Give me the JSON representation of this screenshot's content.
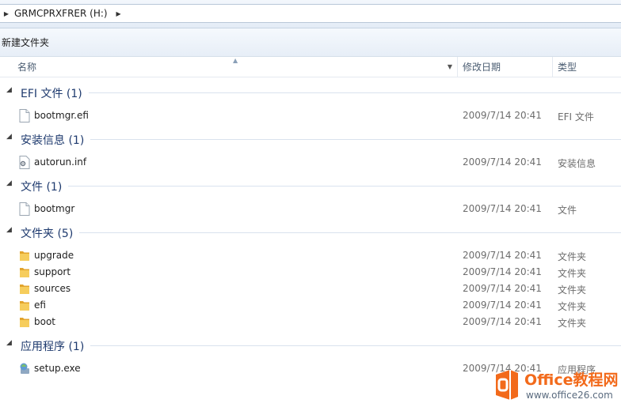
{
  "address": {
    "path": "GRMCPRXFRER (H:)"
  },
  "toolbar": {
    "new_folder": "新建文件夹"
  },
  "columns": {
    "name": "名称",
    "date": "修改日期",
    "type": "类型"
  },
  "groups": [
    {
      "title": "EFI 文件 (1)",
      "items": [
        {
          "name": "bootmgr.efi",
          "date": "2009/7/14 20:41",
          "type": "EFI 文件",
          "icon": "file-icon"
        }
      ]
    },
    {
      "title": "安装信息 (1)",
      "items": [
        {
          "name": "autorun.inf",
          "date": "2009/7/14 20:41",
          "type": "安装信息",
          "icon": "setup-info-icon"
        }
      ]
    },
    {
      "title": "文件 (1)",
      "items": [
        {
          "name": "bootmgr",
          "date": "2009/7/14 20:41",
          "type": "文件",
          "icon": "file-icon"
        }
      ]
    },
    {
      "title": "文件夹 (5)",
      "items": [
        {
          "name": "upgrade",
          "date": "2009/7/14 20:41",
          "type": "文件夹",
          "icon": "folder-icon"
        },
        {
          "name": "support",
          "date": "2009/7/14 20:41",
          "type": "文件夹",
          "icon": "folder-icon"
        },
        {
          "name": "sources",
          "date": "2009/7/14 20:41",
          "type": "文件夹",
          "icon": "folder-icon"
        },
        {
          "name": "efi",
          "date": "2009/7/14 20:41",
          "type": "文件夹",
          "icon": "folder-icon"
        },
        {
          "name": "boot",
          "date": "2009/7/14 20:41",
          "type": "文件夹",
          "icon": "folder-icon"
        }
      ]
    },
    {
      "title": "应用程序 (1)",
      "items": [
        {
          "name": "setup.exe",
          "date": "2009/7/14 20:41",
          "type": "应用程序",
          "icon": "setup-exe-icon"
        }
      ]
    }
  ],
  "watermark": {
    "title": "Office教程网",
    "url": "www.office26.com"
  },
  "colors": {
    "group_title": "#1e3a6e",
    "folder": "#f2c14e",
    "watermark": "#f26a1b"
  }
}
